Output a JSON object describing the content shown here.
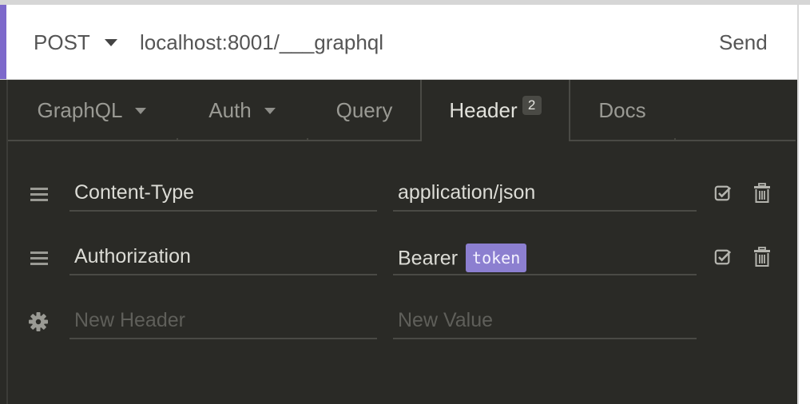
{
  "request": {
    "method": "POST",
    "url": "localhost:8001/___graphql",
    "send_label": "Send"
  },
  "tabs": [
    {
      "label": "GraphQL",
      "dropdown": true
    },
    {
      "label": "Auth",
      "dropdown": true
    },
    {
      "label": "Query",
      "dropdown": false
    },
    {
      "label": "Header",
      "badge": "2",
      "active": true
    },
    {
      "label": "Docs",
      "dropdown": false
    }
  ],
  "headers": [
    {
      "name": "Content-Type",
      "value": "application/json",
      "enabled": true
    },
    {
      "name": "Authorization",
      "value_prefix": "Bearer",
      "value_tag": "token",
      "enabled": true
    }
  ],
  "new_row": {
    "name_placeholder": "New Header",
    "value_placeholder": "New Value"
  },
  "colors": {
    "accent": "#7d69cb",
    "tag": "#8c7fd0",
    "panel_bg": "#2a2a26"
  },
  "icons": [
    "chevron-down-icon",
    "drag-handle-icon",
    "checkbox-checked-icon",
    "trash-icon",
    "gear-icon"
  ]
}
